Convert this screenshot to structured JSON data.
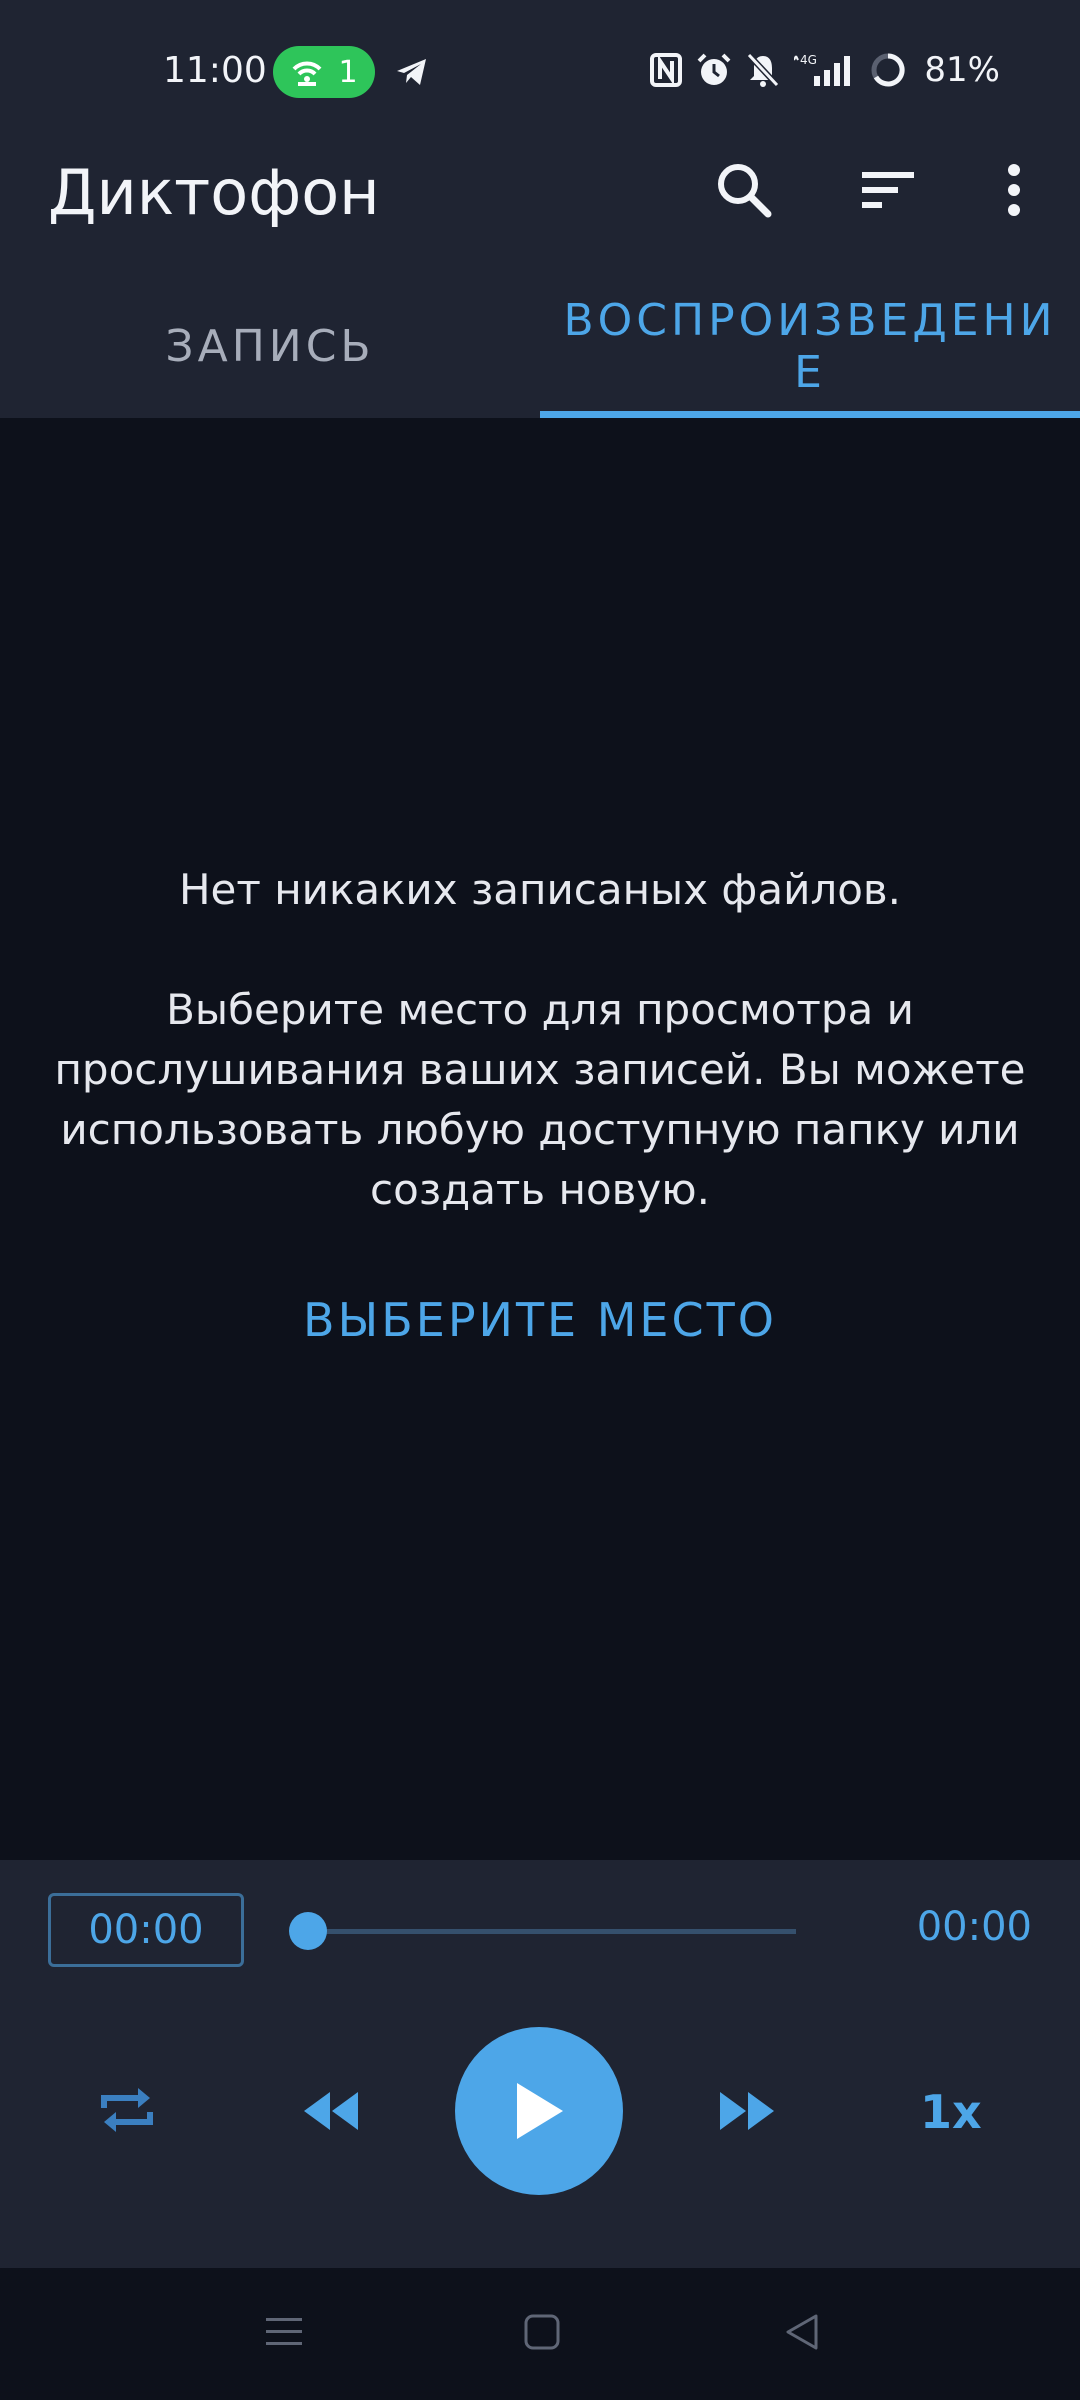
{
  "status_bar": {
    "time": "11:00",
    "hotspot_count": "1",
    "network": "4G",
    "battery": "81%"
  },
  "app": {
    "title": "Диктофон"
  },
  "tabs": [
    {
      "label": "ЗАПИСЬ",
      "active": false
    },
    {
      "label_line1": "ВОСПРОИЗВЕДЕНИ",
      "label_line2": "Е",
      "active": true
    }
  ],
  "empty_state": {
    "title": "Нет никаких записаных файлов.",
    "description": "Выберите место для просмотра и прослушивания ваших записей. Вы можете использовать любую доступную папку или создать новую.",
    "action": "ВЫБЕРИТЕ МЕСТО"
  },
  "player": {
    "current_time": "00:00",
    "total_time": "00:00",
    "progress": 0,
    "speed": "1x"
  },
  "icons": {
    "search": "search-icon",
    "sort": "sort-icon",
    "more": "more-vert-icon",
    "repeat": "repeat-icon",
    "rewind": "rewind-icon",
    "play": "play-icon",
    "fast_forward": "fast-forward-icon"
  },
  "colors": {
    "accent": "#4da6e8",
    "surface": "#1f2432",
    "background": "#0d111b",
    "hotspot": "#2ec55a"
  }
}
